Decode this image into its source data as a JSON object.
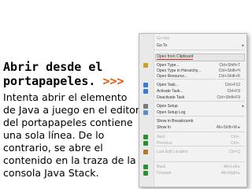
{
  "slide": {
    "heading_line1": "Abrir desde el",
    "heading_line2": "portapapeles.",
    "heading_arrows": ">>>",
    "body": "Intenta abrir el elemento de Java a juego en el editor del portapapeles contiene una sola línea. De lo contrario, se abre el contenido en la traza de la consola Java Stack."
  },
  "menu": {
    "items": [
      {
        "label": "Go Into",
        "shortcut": "",
        "disabled": true
      },
      {
        "label": "Go To",
        "shortcut": "",
        "arrow": "▸"
      },
      {
        "label": "Open from Clipboard",
        "shortcut": ""
      },
      {
        "label": "Open Type...",
        "shortcut": "Ctrl+Shift+T",
        "icon": "open-type-icon",
        "icon_color": "#c9a227"
      },
      {
        "label": "Open Type in Hierarchy...",
        "shortcut": "Ctrl+Shift+H"
      },
      {
        "label": "Open Resource...",
        "shortcut": "Ctrl+Shift+R"
      },
      {
        "label": "Open Task...",
        "shortcut": "Ctrl+F12",
        "icon": "task-icon",
        "icon_color": "#3a7bd5"
      },
      {
        "label": "Activate Task...",
        "shortcut": "Ctrl+F9",
        "icon": "activate-task-icon",
        "icon_color": "#3a7bd5"
      },
      {
        "label": "Deactivate Task",
        "shortcut": "Ctrl+Shift+F9"
      },
      {
        "label": "Open Setup",
        "shortcut": "",
        "arrow": "▸",
        "icon": "setup-icon",
        "icon_color": "#7a7a7a"
      },
      {
        "label": "Open Setup Log",
        "shortcut": "",
        "icon": "setup-log-icon",
        "icon_color": "#5a8fd0"
      },
      {
        "label": "Show in Breadcrumb",
        "shortcut": ""
      },
      {
        "label": "Show In",
        "shortcut": "Alt+Shift+W ▸"
      },
      {
        "label": "Next",
        "shortcut": "Ctrl+.",
        "icon": "next-icon",
        "icon_color": "#2f8f2f"
      },
      {
        "label": "Previous",
        "shortcut": "Ctrl+,",
        "icon": "previous-icon",
        "icon_color": "#2f8f2f"
      },
      {
        "label": "Last Edit Location",
        "shortcut": "Ctrl+Q",
        "icon": "last-edit-icon",
        "icon_color": "#b07a2a"
      },
      {
        "label": "Back",
        "shortcut": "Alt+Left ▸",
        "icon": "back-icon",
        "icon_color": "#2f8f2f"
      },
      {
        "label": "Forward",
        "shortcut": "Alt+Right ▸",
        "icon": "forward-icon",
        "icon_color": "#2f8f2f"
      }
    ]
  },
  "colors": {
    "accent_arrows": "#e05a10",
    "highlight_underline": "#d9221c"
  }
}
